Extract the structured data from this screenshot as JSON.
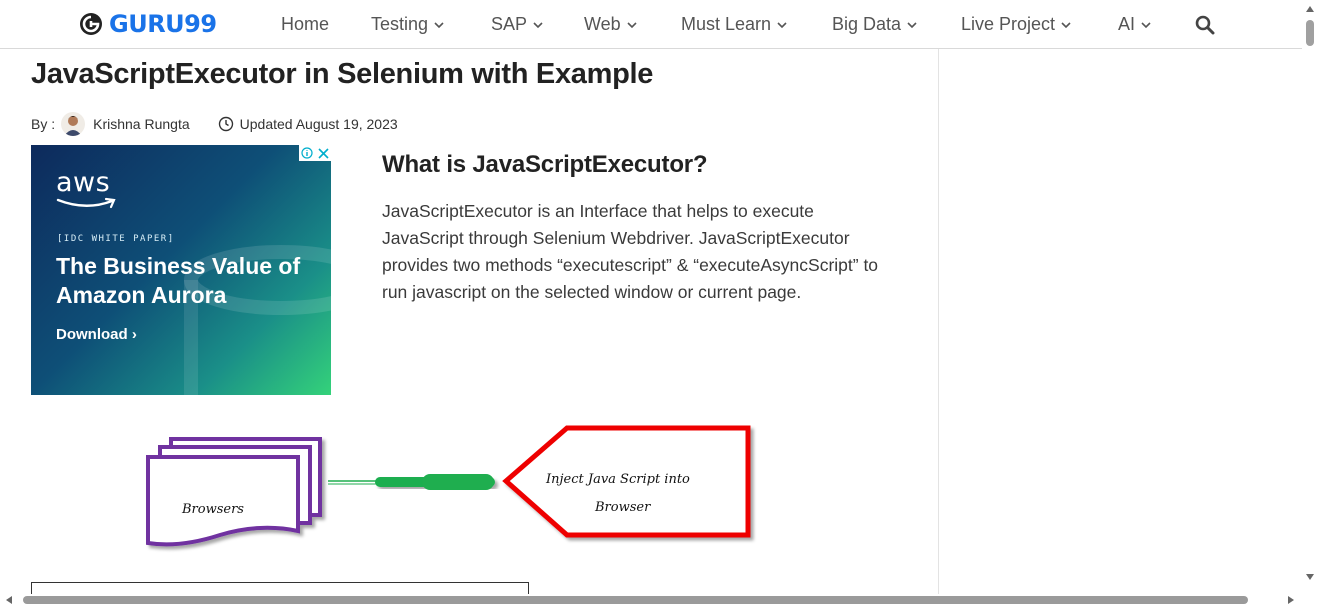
{
  "logo": {
    "text": "GURU99"
  },
  "nav": {
    "items": [
      {
        "label": "Home",
        "has_dropdown": false
      },
      {
        "label": "Testing",
        "has_dropdown": true
      },
      {
        "label": "SAP",
        "has_dropdown": true
      },
      {
        "label": "Web",
        "has_dropdown": true
      },
      {
        "label": "Must Learn",
        "has_dropdown": true
      },
      {
        "label": "Big Data",
        "has_dropdown": true
      },
      {
        "label": "Live Project",
        "has_dropdown": true
      },
      {
        "label": "AI",
        "has_dropdown": true
      }
    ],
    "search_icon": "search-icon"
  },
  "article": {
    "title": "JavaScriptExecutor in Selenium with Example",
    "by_label": "By :",
    "author": "Krishna Rungta",
    "updated": "Updated August 19, 2023"
  },
  "ad": {
    "brand": "aws",
    "tag": "[IDC WHITE PAPER]",
    "headline": "The Business Value of Amazon Aurora",
    "cta": "Download ›"
  },
  "section": {
    "title": "What is JavaScriptExecutor?",
    "body": "JavaScriptExecutor is an Interface that helps to execute JavaScript through Selenium Webdriver. JavaScriptExecutor provides two methods “executescript” & “executeAsyncScript” to run javascript on the selected window or current page."
  },
  "diagram": {
    "left_label": "Browsers",
    "right_label_line1": "Inject Java Script into",
    "right_label_line2": "Browser"
  },
  "colors": {
    "brand_blue": "#1a73e8",
    "diagram_purple": "#7030a0",
    "diagram_red": "#ee0000",
    "diagram_green": "#1fae4f"
  }
}
